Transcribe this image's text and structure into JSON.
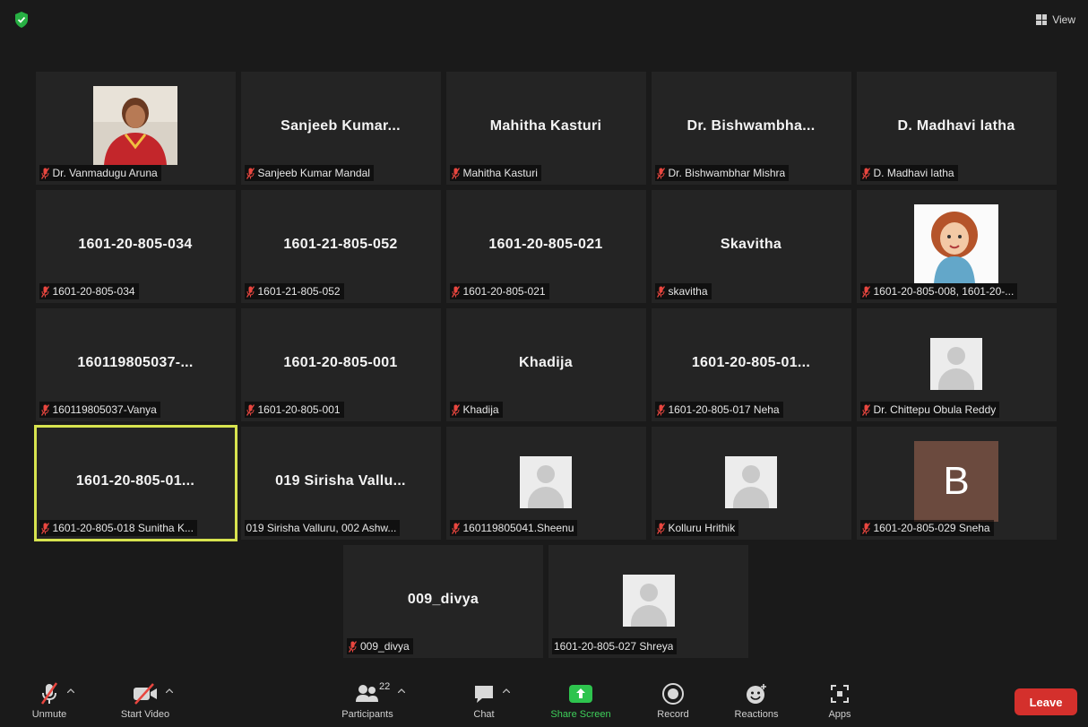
{
  "top_bar": {
    "view_label": "View"
  },
  "tiles": [
    {
      "display": "",
      "caption": "Dr. Vanmadugu Aruna",
      "avatar": "photo-woman"
    },
    {
      "display": "Sanjeeb Kumar...",
      "caption": "Sanjeeb Kumar Mandal"
    },
    {
      "display": "Mahitha Kasturi",
      "caption": "Mahitha Kasturi"
    },
    {
      "display": "Dr. Bishwambha...",
      "caption": "Dr. Bishwambhar Mishra"
    },
    {
      "display": "D. Madhavi latha",
      "caption": "D. Madhavi latha"
    },
    {
      "display": "1601-20-805-034",
      "caption": "1601-20-805-034"
    },
    {
      "display": "1601-21-805-052",
      "caption": "1601-21-805-052"
    },
    {
      "display": "1601-20-805-021",
      "caption": "1601-20-805-021"
    },
    {
      "display": "Skavitha",
      "caption": "skavitha"
    },
    {
      "display": "",
      "caption": "1601-20-805-008, 1601-20-...",
      "avatar": "cartoon"
    },
    {
      "display": "160119805037-...",
      "caption": "160119805037-Vanya"
    },
    {
      "display": "1601-20-805-001",
      "caption": "1601-20-805-001"
    },
    {
      "display": "Khadija",
      "caption": "Khadija"
    },
    {
      "display": "1601-20-805-01...",
      "caption": "1601-20-805-017 Neha"
    },
    {
      "display": "",
      "caption": "Dr. Chittepu Obula Reddy",
      "avatar": "generic"
    },
    {
      "display": "1601-20-805-01...",
      "caption": "1601-20-805-018 Sunitha K...",
      "active": true
    },
    {
      "display": "019 Sirisha Vallu...",
      "caption": "019 Sirisha Valluru, 002 Ashw...",
      "no_mic_icon": true
    },
    {
      "display": "",
      "caption": "160119805041.Sheenu",
      "avatar": "generic"
    },
    {
      "display": "",
      "caption": "Kolluru Hrithik",
      "avatar": "generic"
    },
    {
      "display": "",
      "caption": "1601-20-805-029 Sneha",
      "avatar": "letter",
      "letter": "B"
    },
    {
      "display": "009_divya",
      "caption": "009_divya"
    },
    {
      "display": "",
      "caption": "1601-20-805-027 Shreya",
      "avatar": "generic",
      "no_mic_icon": true
    }
  ],
  "toolbar": {
    "unmute": "Unmute",
    "start_video": "Start Video",
    "participants": "Participants",
    "participant_count": "22",
    "chat": "Chat",
    "share_screen": "Share Screen",
    "record": "Record",
    "reactions": "Reactions",
    "apps": "Apps",
    "leave": "Leave"
  },
  "colors": {
    "active_speaker_border": "#d7e34f",
    "share_green": "#3ecf5a",
    "leave_red": "#d4302c",
    "muted_red": "#e8463f"
  }
}
